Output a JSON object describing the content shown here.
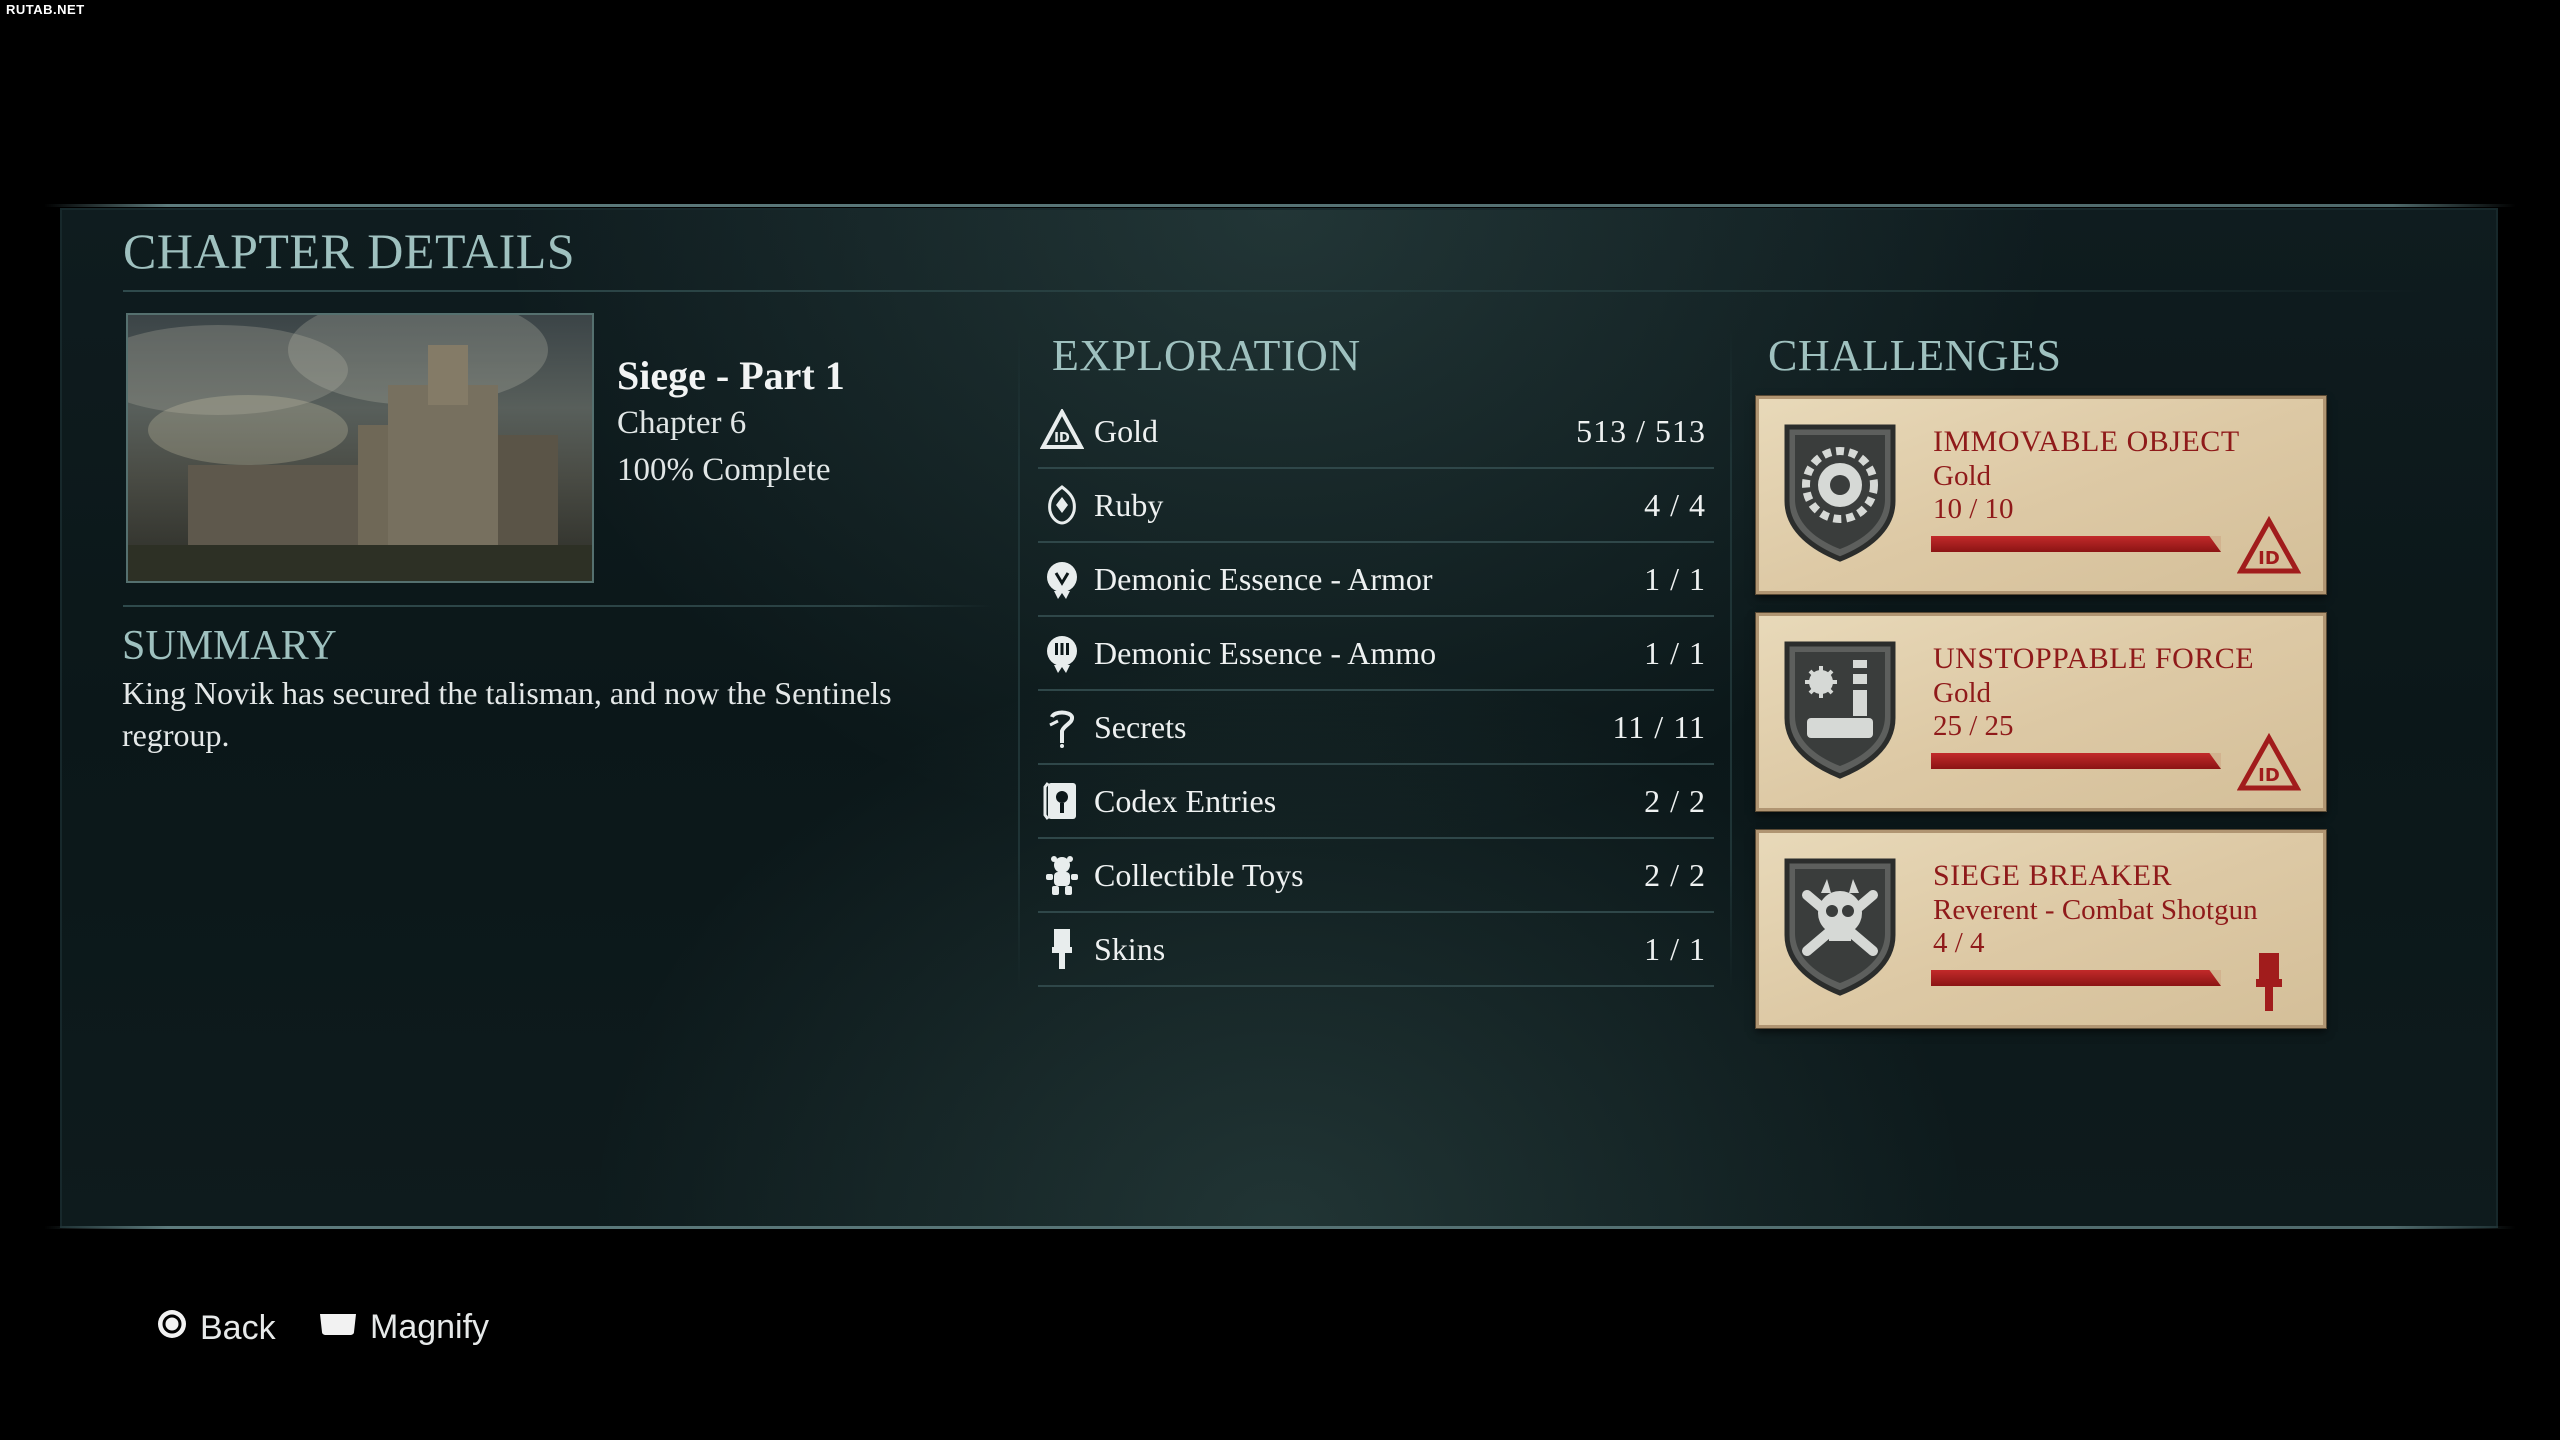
{
  "watermark": "RUTAB.NET",
  "header": {
    "title": "CHAPTER DETAILS"
  },
  "chapter": {
    "name": "Siege - Part 1",
    "number": "Chapter 6",
    "completion": "100% Complete"
  },
  "summary": {
    "heading": "SUMMARY",
    "text": "King Novik has secured the talisman, and now the Sentinels regroup."
  },
  "exploration": {
    "heading": "EXPLORATION",
    "items": [
      {
        "icon": "gold-icon",
        "label": "Gold",
        "value": "513 / 513"
      },
      {
        "icon": "ruby-icon",
        "label": "Ruby",
        "value": "4 / 4"
      },
      {
        "icon": "demonic-essence-armor-icon",
        "label": "Demonic Essence - Armor",
        "value": "1 / 1"
      },
      {
        "icon": "demonic-essence-ammo-icon",
        "label": "Demonic Essence - Ammo",
        "value": "1 / 1"
      },
      {
        "icon": "secrets-icon",
        "label": "Secrets",
        "value": "11 / 11"
      },
      {
        "icon": "codex-icon",
        "label": "Codex Entries",
        "value": "2 / 2"
      },
      {
        "icon": "toy-icon",
        "label": "Collectible Toys",
        "value": "2 / 2"
      },
      {
        "icon": "skins-icon",
        "label": "Skins",
        "value": "1 / 1"
      }
    ]
  },
  "challenges": {
    "heading": "CHALLENGES",
    "items": [
      {
        "title": "IMMOVABLE OBJECT",
        "reward": "Gold",
        "progress": "10 / 10",
        "progress_fraction": 1.0,
        "badge_icon": "gear-shield-icon",
        "reward_icon": "gold-icon"
      },
      {
        "title": "UNSTOPPABLE FORCE",
        "reward": "Gold",
        "progress": "25 / 25",
        "progress_fraction": 1.0,
        "badge_icon": "weapons-shield-icon",
        "reward_icon": "gold-icon"
      },
      {
        "title": "SIEGE BREAKER",
        "reward": "Reverent - Combat Shotgun",
        "progress": "4 / 4",
        "progress_fraction": 1.0,
        "badge_icon": "skull-crossbones-shield-icon",
        "reward_icon": "paintbrush-icon"
      }
    ]
  },
  "footer": {
    "back_label": "Back",
    "magnify_label": "Magnify"
  },
  "colors": {
    "accent_teal": "#9fc1bf",
    "challenge_red": "#8f1a1a",
    "card_parchment": "#e8d9b9"
  }
}
